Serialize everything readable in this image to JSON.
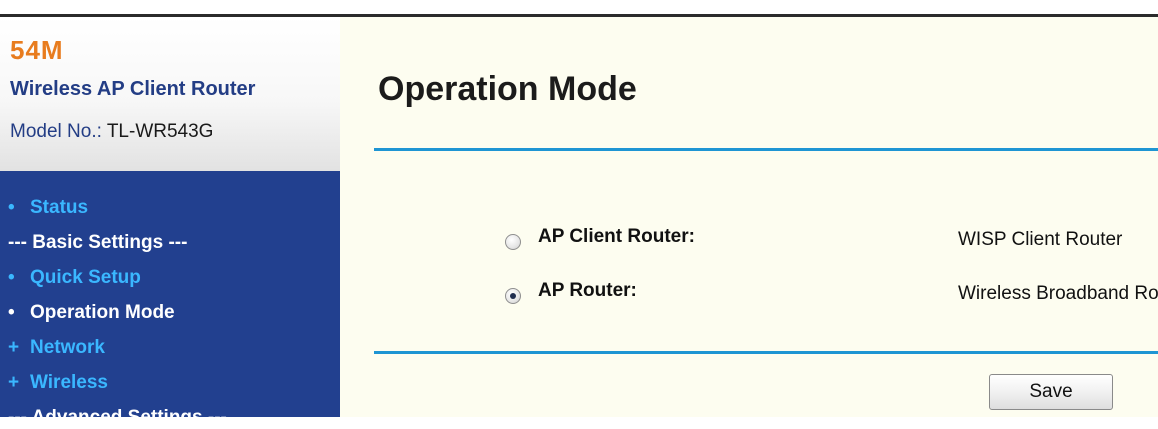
{
  "brand": {
    "speed": "54M",
    "product": "Wireless AP Client Router",
    "model_label": "Model No.:",
    "model_value": "TL-WR543G"
  },
  "sidebar": {
    "items": [
      {
        "label": "Status",
        "bullet": "•",
        "kind": "link"
      },
      {
        "label": "--- Basic Settings ---",
        "bullet": "",
        "kind": "section-header"
      },
      {
        "label": "Quick Setup",
        "bullet": "•",
        "kind": "link"
      },
      {
        "label": "Operation Mode",
        "bullet": "•",
        "kind": "link-active"
      },
      {
        "label": "Network",
        "bullet": "+",
        "kind": "expandable"
      },
      {
        "label": "Wireless",
        "bullet": "+",
        "kind": "expandable"
      },
      {
        "label": "--- Advanced Settings ---",
        "bullet": "",
        "kind": "section-header"
      }
    ]
  },
  "main": {
    "title": "Operation Mode",
    "options": [
      {
        "label": "AP Client Router:",
        "description": "WISP Client Router",
        "selected": false
      },
      {
        "label": "AP Router:",
        "description": "Wireless Broadband Router",
        "selected": true
      }
    ],
    "save_label": "Save"
  },
  "colors": {
    "brand_orange": "#e87c1e",
    "brand_blue": "#233d85",
    "sidebar_bg": "#22408f",
    "link_blue": "#3ab7ff",
    "rule_blue": "#1e95d3",
    "content_bg": "#fdfdf0"
  }
}
